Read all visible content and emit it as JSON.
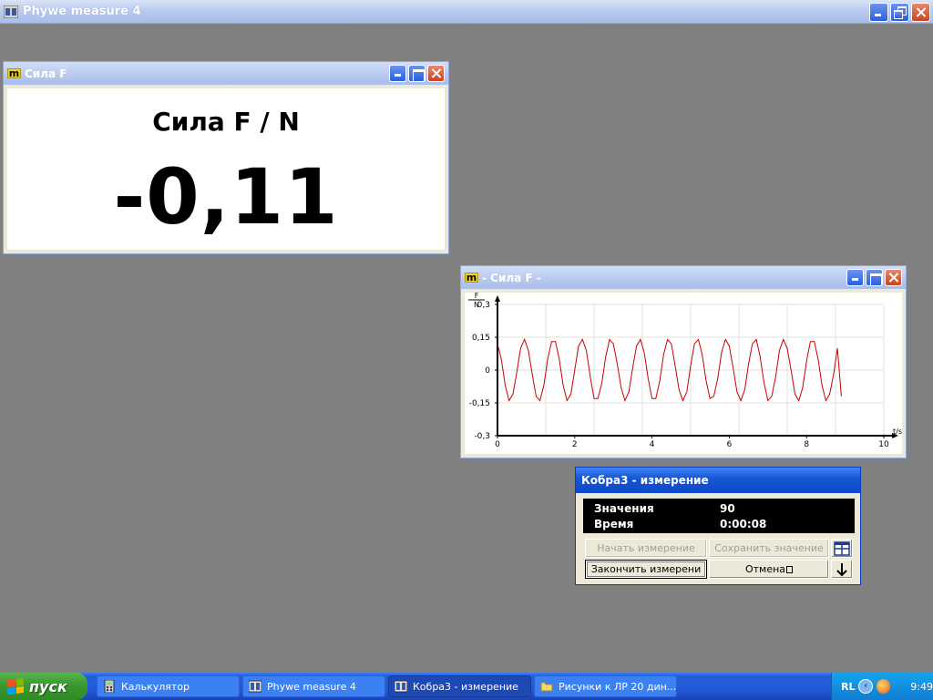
{
  "app": {
    "title": "Phywe measure 4"
  },
  "meter_window": {
    "title": "Сила F",
    "quantity_label": "Сила F / N",
    "value": "-0,11"
  },
  "graph_window": {
    "title": "- Сила F -"
  },
  "chart_data": {
    "type": "line",
    "xlabel": "t/s",
    "ylabel_top": "F",
    "ylabel_bottom": "N",
    "xlim": [
      0,
      10
    ],
    "ylim": [
      -0.3,
      0.3
    ],
    "x_ticks": [
      "0",
      "2",
      "4",
      "6",
      "8",
      "10"
    ],
    "y_ticks": [
      "0,3",
      "0,15",
      "0",
      "-0,15",
      "-0,3"
    ],
    "grid": true,
    "series": [
      {
        "color": "#cc0000",
        "x": [
          0,
          0.1,
          0.2,
          0.3,
          0.4,
          0.5,
          0.6,
          0.7,
          0.8,
          0.9,
          1.0,
          1.1,
          1.2,
          1.3,
          1.4,
          1.5,
          1.6,
          1.7,
          1.8,
          1.9,
          2.0,
          2.1,
          2.2,
          2.3,
          2.4,
          2.5,
          2.6,
          2.7,
          2.8,
          2.9,
          3.0,
          3.1,
          3.2,
          3.3,
          3.4,
          3.5,
          3.6,
          3.7,
          3.8,
          3.9,
          4.0,
          4.1,
          4.2,
          4.3,
          4.4,
          4.5,
          4.6,
          4.7,
          4.8,
          4.9,
          5.0,
          5.1,
          5.2,
          5.3,
          5.4,
          5.5,
          5.6,
          5.7,
          5.8,
          5.9,
          6.0,
          6.1,
          6.2,
          6.3,
          6.4,
          6.5,
          6.6,
          6.7,
          6.8,
          6.9,
          7.0,
          7.1,
          7.2,
          7.3,
          7.4,
          7.5,
          7.6,
          7.7,
          7.8,
          7.9,
          8.0,
          8.1,
          8.2,
          8.3,
          8.4,
          8.5,
          8.6,
          8.7,
          8.8,
          8.9
        ],
        "y": [
          0.12,
          0.05,
          -0.07,
          -0.14,
          -0.11,
          -0.01,
          0.1,
          0.14,
          0.09,
          -0.02,
          -0.12,
          -0.14,
          -0.07,
          0.05,
          0.13,
          0.13,
          0.05,
          -0.07,
          -0.14,
          -0.11,
          0.0,
          0.11,
          0.14,
          0.09,
          -0.03,
          -0.13,
          -0.13,
          -0.06,
          0.06,
          0.14,
          0.12,
          0.03,
          -0.08,
          -0.14,
          -0.1,
          0.01,
          0.11,
          0.14,
          0.08,
          -0.04,
          -0.13,
          -0.13,
          -0.05,
          0.07,
          0.14,
          0.12,
          0.02,
          -0.09,
          -0.14,
          -0.1,
          0.02,
          0.12,
          0.14,
          0.07,
          -0.05,
          -0.13,
          -0.12,
          -0.04,
          0.08,
          0.14,
          0.11,
          0.01,
          -0.1,
          -0.14,
          -0.09,
          0.03,
          0.12,
          0.14,
          0.06,
          -0.06,
          -0.14,
          -0.12,
          -0.03,
          0.09,
          0.14,
          0.1,
          0.0,
          -0.11,
          -0.14,
          -0.08,
          0.04,
          0.13,
          0.13,
          0.05,
          -0.07,
          -0.14,
          -0.11,
          -0.02,
          0.1,
          -0.12
        ]
      }
    ]
  },
  "measure_dialog": {
    "title": "Кобра3 - измерение",
    "values_label": "Значения",
    "values_count": "90",
    "time_label": "Время",
    "time_value": "0:00:08",
    "start_label": "Начать измерение",
    "save_label": "Сохранить значение",
    "finish_label": "Закончить измерени",
    "cancel_label": "Отмена"
  },
  "taskbar": {
    "start_label": "пуск",
    "tasks": [
      {
        "label": "Калькулятор"
      },
      {
        "label": "Phywe measure 4"
      },
      {
        "label": "Кобра3 - измерение"
      },
      {
        "label": "Рисунки к ЛР 20 дин..."
      }
    ],
    "language": "RL",
    "clock": "9:49"
  },
  "colors": {
    "desktop": "#808080",
    "accent": "#245edb",
    "plot_line": "#cc0000"
  }
}
